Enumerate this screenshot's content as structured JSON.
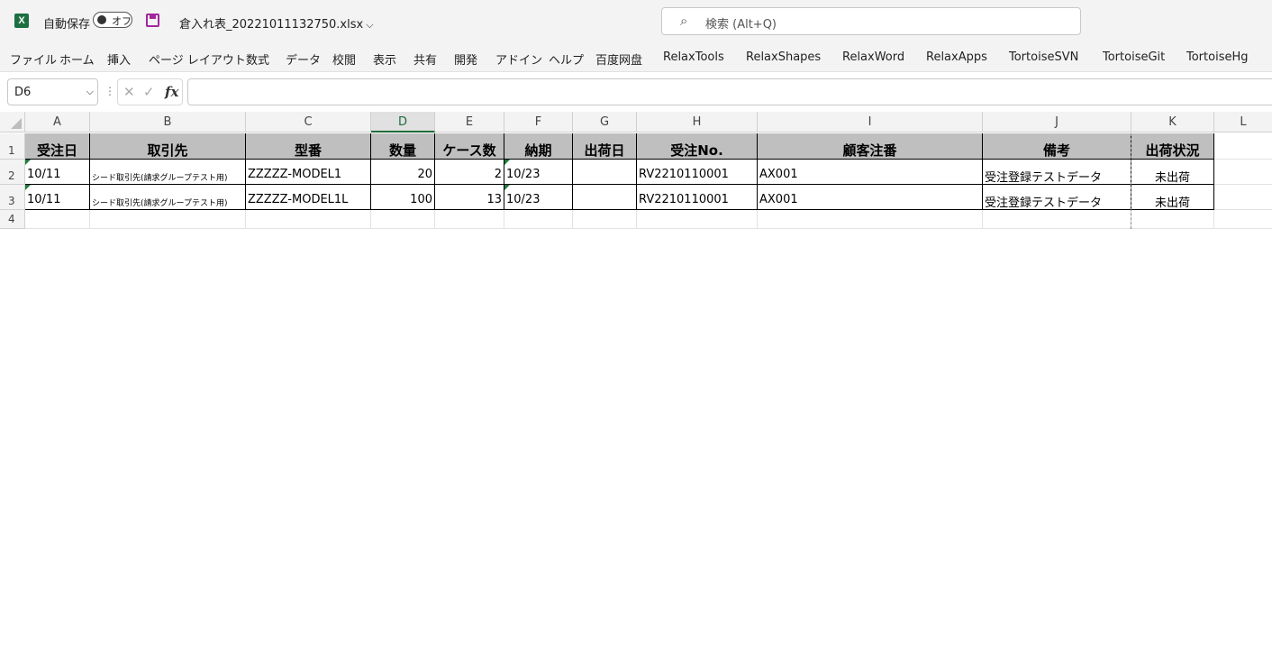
{
  "titlebar": {
    "app_icon": "excel-icon",
    "autosave_label": "自動保存",
    "autosave_state": "オフ",
    "filename": "倉入れ表_20221011132750.xlsx",
    "search_placeholder": "検索 (Alt+Q)"
  },
  "menu": [
    "ファイル",
    "ホーム",
    "挿入",
    "ページ レイアウト",
    "数式",
    "データ",
    "校閲",
    "表示",
    "共有",
    "開発",
    "アドイン",
    "ヘルプ",
    "百度网盘",
    "RelaxTools",
    "RelaxShapes",
    "RelaxWord",
    "RelaxApps",
    "TortoiseSVN",
    "TortoiseGit",
    "TortoiseHg"
  ],
  "formula_bar": {
    "name_box": "D6",
    "fx": "fx",
    "formula": ""
  },
  "columns": [
    "A",
    "B",
    "C",
    "D",
    "E",
    "F",
    "G",
    "H",
    "I",
    "J",
    "K",
    "L"
  ],
  "selected_column": "D",
  "rows": [
    "1",
    "2",
    "3",
    "4"
  ],
  "table": {
    "headers": [
      "受注日",
      "取引先",
      "型番",
      "数量",
      "ケース数",
      "納期",
      "出荷日",
      "受注No.",
      "顧客注番",
      "備考",
      "出荷状況"
    ],
    "data": [
      [
        "10/11",
        "シード取引先(請求グループテスト用)",
        "ZZZZZ-MODEL1",
        "20",
        "2",
        "10/23",
        "",
        "RV2210110001",
        "AX001",
        "受注登録テストデータ",
        "未出荷"
      ],
      [
        "10/11",
        "シード取引先(請求グループテスト用)",
        "ZZZZZ-MODEL1L",
        "100",
        "13",
        "10/23",
        "",
        "RV2210110001",
        "AX001",
        "受注登録テストデータ",
        "未出荷"
      ]
    ]
  }
}
